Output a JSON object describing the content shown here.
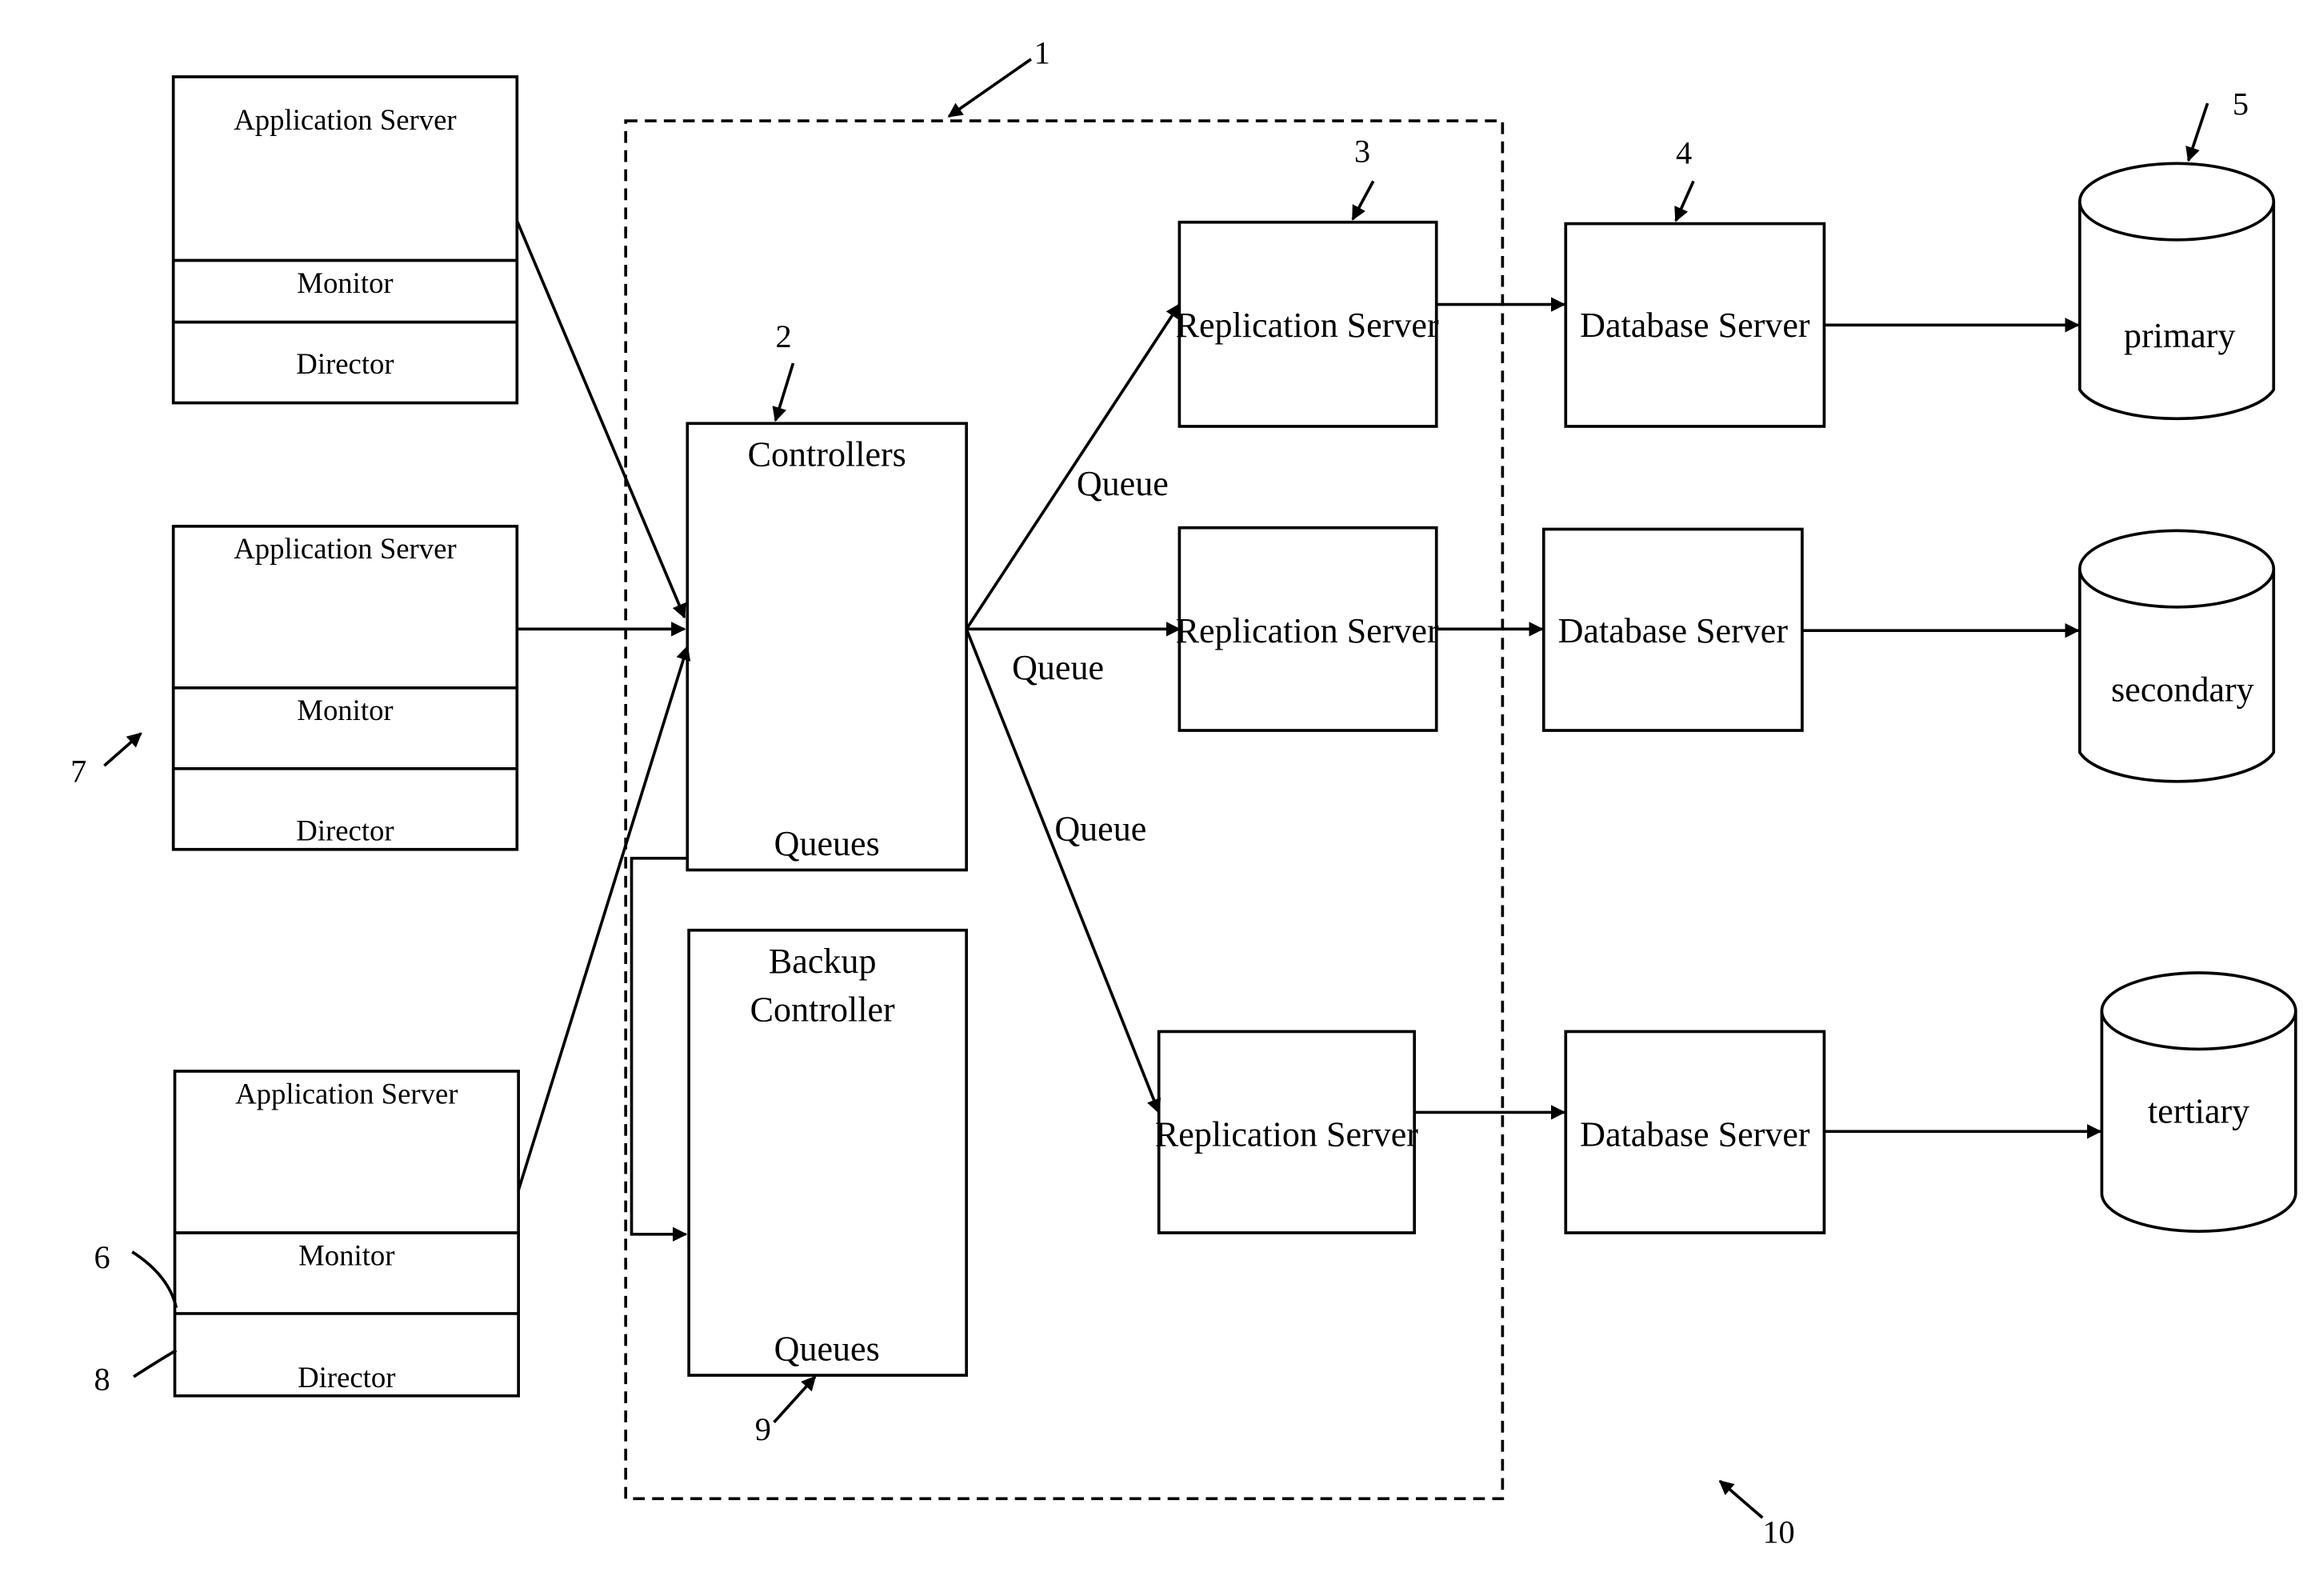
{
  "figure": {
    "app_servers": [
      {
        "title": "Application Server",
        "monitor": "Monitor",
        "director": "Director"
      },
      {
        "title": "Application Server",
        "monitor": "Monitor",
        "director": "Director"
      },
      {
        "title": "Application Server",
        "monitor": "Monitor",
        "director": "Director"
      }
    ],
    "controllers": {
      "title": "Controllers",
      "queues": "Queues"
    },
    "backup_controller": {
      "title_line1": "Backup",
      "title_line2": "Controller",
      "queues": "Queues"
    },
    "replication_servers": [
      "Replication Server",
      "Replication Server",
      "Replication Server"
    ],
    "database_servers": [
      "Database Server",
      "Database Server",
      "Database Server"
    ],
    "databases": [
      "primary",
      "secondary",
      "tertiary"
    ],
    "queue_labels": [
      "Queue",
      "Queue",
      "Queue"
    ],
    "ref_numbers": {
      "n1": "1",
      "n2": "2",
      "n3": "3",
      "n4": "4",
      "n5": "5",
      "n6": "6",
      "n7": "7",
      "n8": "8",
      "n9": "9",
      "n10": "10"
    }
  }
}
